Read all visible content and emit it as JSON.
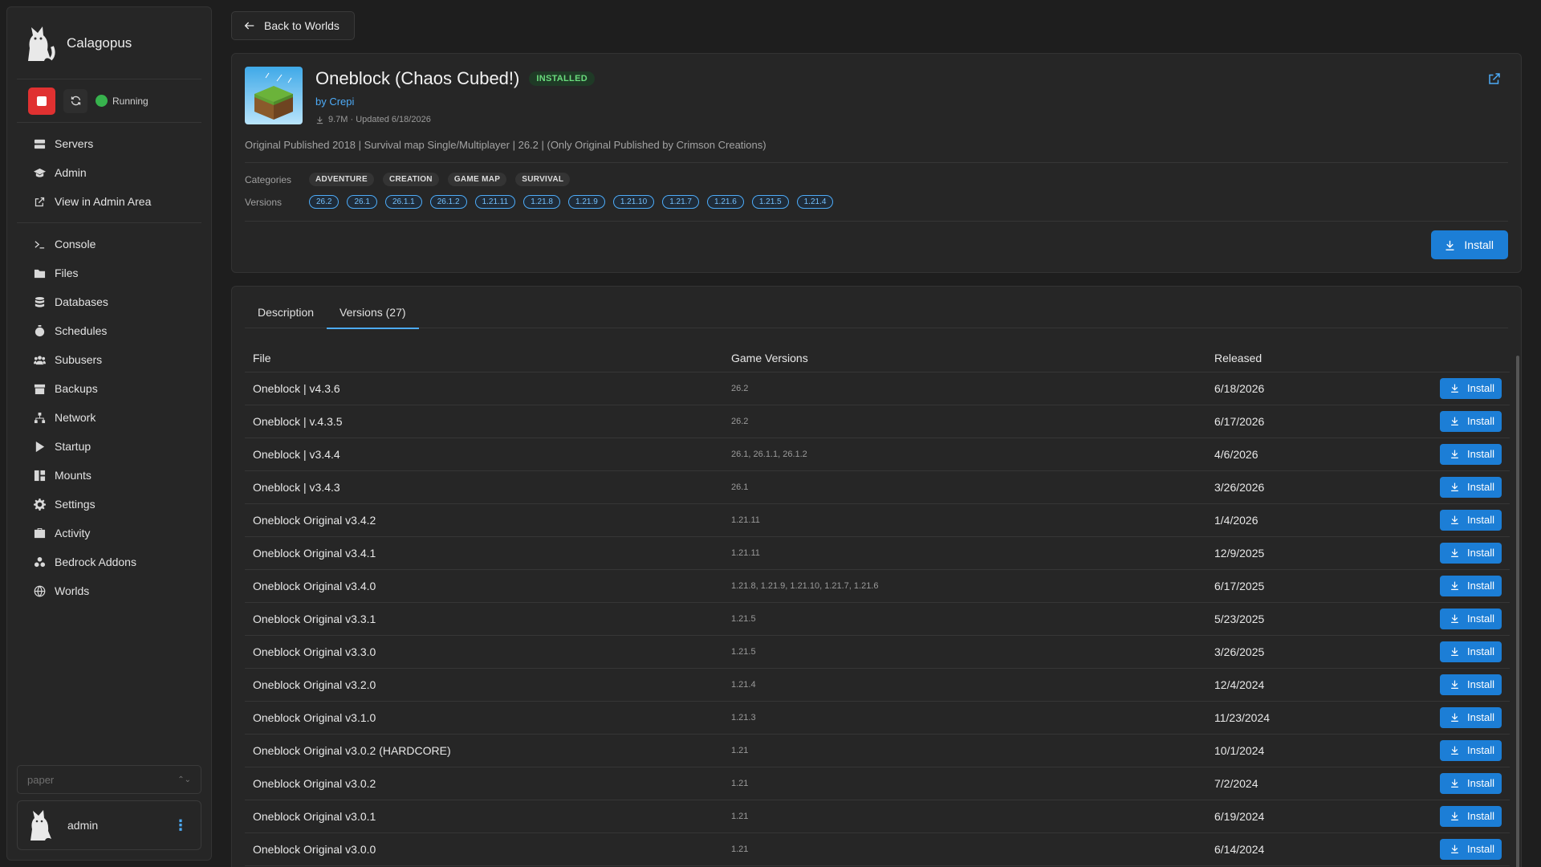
{
  "brand": {
    "name": "Calagopus"
  },
  "server_status": {
    "label": "Running",
    "color": "#37b24d"
  },
  "nav": {
    "group1": [
      {
        "label": "Servers",
        "icon": "servers-icon"
      },
      {
        "label": "Admin",
        "icon": "graduation-cap-icon"
      },
      {
        "label": "View in Admin Area",
        "icon": "external-link-icon"
      }
    ],
    "group2": [
      {
        "label": "Console",
        "icon": "terminal-icon"
      },
      {
        "label": "Files",
        "icon": "folder-icon"
      },
      {
        "label": "Databases",
        "icon": "database-icon"
      },
      {
        "label": "Schedules",
        "icon": "stopwatch-icon"
      },
      {
        "label": "Subusers",
        "icon": "users-icon"
      },
      {
        "label": "Backups",
        "icon": "archive-icon"
      },
      {
        "label": "Network",
        "icon": "network-icon"
      },
      {
        "label": "Startup",
        "icon": "play-icon"
      },
      {
        "label": "Mounts",
        "icon": "mounts-icon"
      },
      {
        "label": "Settings",
        "icon": "gear-icon"
      },
      {
        "label": "Activity",
        "icon": "briefcase-icon"
      },
      {
        "label": "Bedrock Addons",
        "icon": "puzzle-icon"
      },
      {
        "label": "Worlds",
        "icon": "globe-icon"
      }
    ]
  },
  "server_select": {
    "value": "paper"
  },
  "user": {
    "name": "admin"
  },
  "back_button": {
    "label": "Back to Worlds"
  },
  "project": {
    "title": "Oneblock (Chaos Cubed!)",
    "badge": "INSTALLED",
    "author": "by Crepi",
    "meta": "9.7M · Updated 6/18/2026",
    "description": "Original Published 2018 | Survival map Single/Multiplayer | 26.2 | (Only Original Published by Crimson Creations)",
    "categories_label": "Categories",
    "categories": [
      "ADVENTURE",
      "CREATION",
      "GAME MAP",
      "SURVIVAL"
    ],
    "versions_label": "Versions",
    "versions": [
      "26.2",
      "26.1",
      "26.1.1",
      "26.1.2",
      "1.21.11",
      "1.21.8",
      "1.21.9",
      "1.21.10",
      "1.21.7",
      "1.21.6",
      "1.21.5",
      "1.21.4"
    ],
    "install_label": "Install"
  },
  "tabs": [
    {
      "label": "Description"
    },
    {
      "label": "Versions (27)"
    }
  ],
  "table": {
    "headers": [
      "File",
      "Game Versions",
      "Released"
    ],
    "install_label": "Install",
    "rows": [
      {
        "file": "Oneblock | v4.3.6",
        "versions": "26.2",
        "released": "6/18/2026"
      },
      {
        "file": "Oneblock | v.4.3.5",
        "versions": "26.2",
        "released": "6/17/2026"
      },
      {
        "file": "Oneblock | v3.4.4",
        "versions": "26.1, 26.1.1, 26.1.2",
        "released": "4/6/2026"
      },
      {
        "file": "Oneblock | v3.4.3",
        "versions": "26.1",
        "released": "3/26/2026"
      },
      {
        "file": "Oneblock Original v3.4.2",
        "versions": "1.21.11",
        "released": "1/4/2026"
      },
      {
        "file": "Oneblock Original v3.4.1",
        "versions": "1.21.11",
        "released": "12/9/2025"
      },
      {
        "file": "Oneblock Original v3.4.0",
        "versions": "1.21.8, 1.21.9, 1.21.10, 1.21.7, 1.21.6",
        "released": "6/17/2025"
      },
      {
        "file": "Oneblock Original v3.3.1",
        "versions": "1.21.5",
        "released": "5/23/2025"
      },
      {
        "file": "Oneblock Original v3.3.0",
        "versions": "1.21.5",
        "released": "3/26/2025"
      },
      {
        "file": "Oneblock Original v3.2.0",
        "versions": "1.21.4",
        "released": "12/4/2024"
      },
      {
        "file": "Oneblock Original v3.1.0",
        "versions": "1.21.3",
        "released": "11/23/2024"
      },
      {
        "file": "Oneblock Original v3.0.2 (HARDCORE)",
        "versions": "1.21",
        "released": "10/1/2024"
      },
      {
        "file": "Oneblock Original v3.0.2",
        "versions": "1.21",
        "released": "7/2/2024"
      },
      {
        "file": "Oneblock Original v3.0.1",
        "versions": "1.21",
        "released": "6/19/2024"
      },
      {
        "file": "Oneblock Original v3.0.0",
        "versions": "1.21",
        "released": "6/14/2024"
      }
    ]
  }
}
